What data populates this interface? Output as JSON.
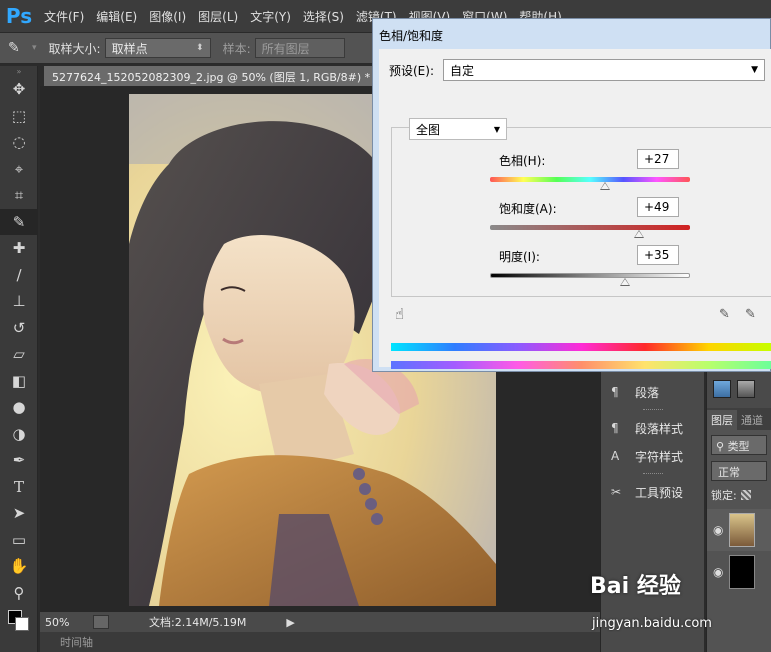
{
  "app": {
    "logo": "Ps"
  },
  "menu": [
    "文件(F)",
    "编辑(E)",
    "图像(I)",
    "图层(L)",
    "文字(Y)",
    "选择(S)",
    "滤镜(T)",
    "视图(V)",
    "窗口(W)",
    "帮助(H)"
  ],
  "options": {
    "sample_size_label": "取样大小:",
    "sample_size_value": "取样点",
    "sample_label": "样本:",
    "sample_value": "所有图层"
  },
  "document": {
    "tab_title": "5277624_152052082309_2.jpg @ 50% (图层 1, RGB/8#) *",
    "zoom": "50%",
    "doc_info": "文档:2.14M/5.19M"
  },
  "timeline": {
    "label": "时间轴"
  },
  "panels": {
    "items": [
      {
        "icon": "paragraph-icon",
        "label": "段落"
      },
      {
        "icon": "paragraph-style-icon",
        "label": "段落样式"
      },
      {
        "icon": "char-style-icon",
        "label": "字符样式"
      },
      {
        "icon": "tool-presets-icon",
        "label": "工具预设"
      }
    ]
  },
  "layers": {
    "tab_layers": "图层",
    "tab_channels": "通道",
    "filter_label": "类型",
    "blend_mode": "正常",
    "lock_label": "锁定:"
  },
  "dialog": {
    "title": "色相/饱和度",
    "preset_label": "预设(E):",
    "preset_value": "自定",
    "channel_value": "全图",
    "hue_label": "色相(H):",
    "hue_value": "+27",
    "saturation_label": "饱和度(A):",
    "saturation_value": "+49",
    "lightness_label": "明度(I):",
    "lightness_value": "+35",
    "hue": 27,
    "saturation": 49,
    "lightness": 35
  },
  "watermark": {
    "brand": "Bai 经验",
    "url": "jingyan.baidu.com"
  },
  "colors": {
    "app_bg": "#2b2b2b",
    "menubar": "#3c3c3c",
    "dialog_title": "#cfe0f3",
    "dialog_body": "#f0f0f0",
    "ps_blue": "#31a8ff"
  }
}
